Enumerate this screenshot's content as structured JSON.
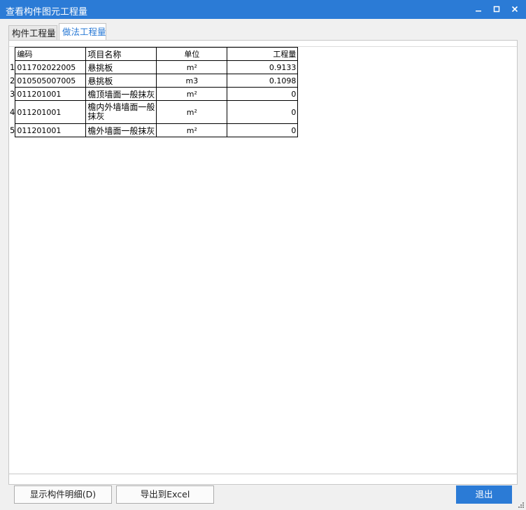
{
  "window": {
    "title": "查看构件图元工程量"
  },
  "tabs": [
    {
      "label": "构件工程量",
      "active": false
    },
    {
      "label": "做法工程量",
      "active": true
    }
  ],
  "table": {
    "columns": [
      "编码",
      "项目名称",
      "单位",
      "工程量"
    ],
    "rows": [
      {
        "index": "1",
        "code": "011702022005",
        "name": "悬挑板",
        "unit": "m²",
        "qty": "0.9133"
      },
      {
        "index": "2",
        "code": "010505007005",
        "name": "悬挑板",
        "unit": "m3",
        "qty": "0.1098"
      },
      {
        "index": "3",
        "code": "011201001",
        "name": "檐顶墙面一般抹灰",
        "unit": "m²",
        "qty": "0"
      },
      {
        "index": "4",
        "code": "011201001",
        "name": "檐内外墙墙面一般抹灰",
        "unit": "m²",
        "qty": "0"
      },
      {
        "index": "5",
        "code": "011201001",
        "name": "檐外墙面一般抹灰",
        "unit": "m²",
        "qty": "0"
      }
    ]
  },
  "buttons": {
    "detail": "显示构件明细(D)",
    "export": "导出到Excel",
    "exit": "退出"
  },
  "colors": {
    "accent": "#2b7bd6"
  }
}
